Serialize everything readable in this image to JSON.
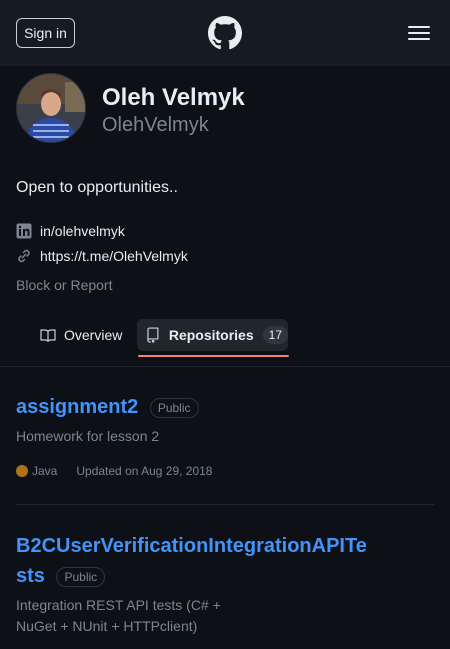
{
  "header": {
    "signin_label": "Sign in",
    "logo_icon": "github-mark-icon",
    "menu_icon": "hamburger-icon"
  },
  "profile": {
    "name": "Oleh Velmyk",
    "login": "OlehVelmyk",
    "bio": "Open to opportunities..",
    "linkedin": "in/olehvelmyk",
    "telegram": "https://t.me/OlehVelmyk",
    "block_label": "Block or Report"
  },
  "tabs": [
    {
      "label": "Overview",
      "icon": "book-icon"
    },
    {
      "label": "Repositories",
      "icon": "repo-icon",
      "count": "17",
      "selected": true
    }
  ],
  "repos": [
    {
      "name": "assignment2",
      "visibility": "Public",
      "description": "Homework for lesson 2",
      "language": "Java",
      "language_color": "#b07219",
      "updated": "Updated on Aug 29, 2018"
    },
    {
      "name_line1": "B2CUserVerificationIntegrationAPITe",
      "name_line2": "sts",
      "visibility": "Public",
      "description_line1": "Integration REST API tests (C# +",
      "description_line2": "NuGet + NUnit + HTTPclient)"
    }
  ],
  "colors": {
    "accent_link": "#4493f8",
    "tab_underline": "#f78166",
    "background": "#0d1117",
    "header_bg": "#161b22"
  }
}
